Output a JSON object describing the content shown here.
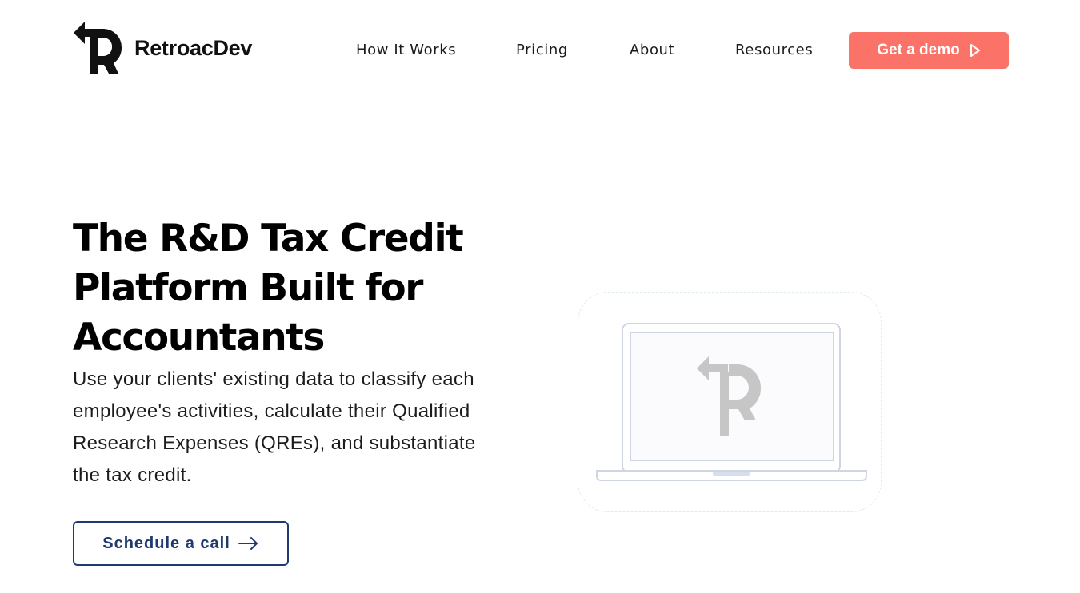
{
  "brand": {
    "name": "RetroacDev",
    "logo_icon": "retroacdev-r-arrow-logo"
  },
  "nav": {
    "items": [
      {
        "label": "How It Works"
      },
      {
        "label": "Pricing"
      },
      {
        "label": "About"
      },
      {
        "label": "Resources"
      }
    ],
    "cta_label": "Get a demo",
    "cta_icon": "play-outline-icon",
    "cta_color": "#fa7268"
  },
  "hero": {
    "title_lines": [
      "The R&D Tax Credit",
      "Platform Built for",
      "Accountants"
    ],
    "description_lines": [
      "Use your clients' existing data to classify each",
      "employee's activities, calculate their Qualified",
      "Research Expenses (QREs), and substantiate",
      "the tax credit."
    ],
    "secondary_cta_label": "Schedule a call",
    "secondary_cta_icon": "arrow-right-icon",
    "secondary_cta_color": "#1e3a6e"
  },
  "illustration": {
    "icon": "laptop-icon",
    "screen_logo": "retroacdev-r-arrow-logo"
  }
}
